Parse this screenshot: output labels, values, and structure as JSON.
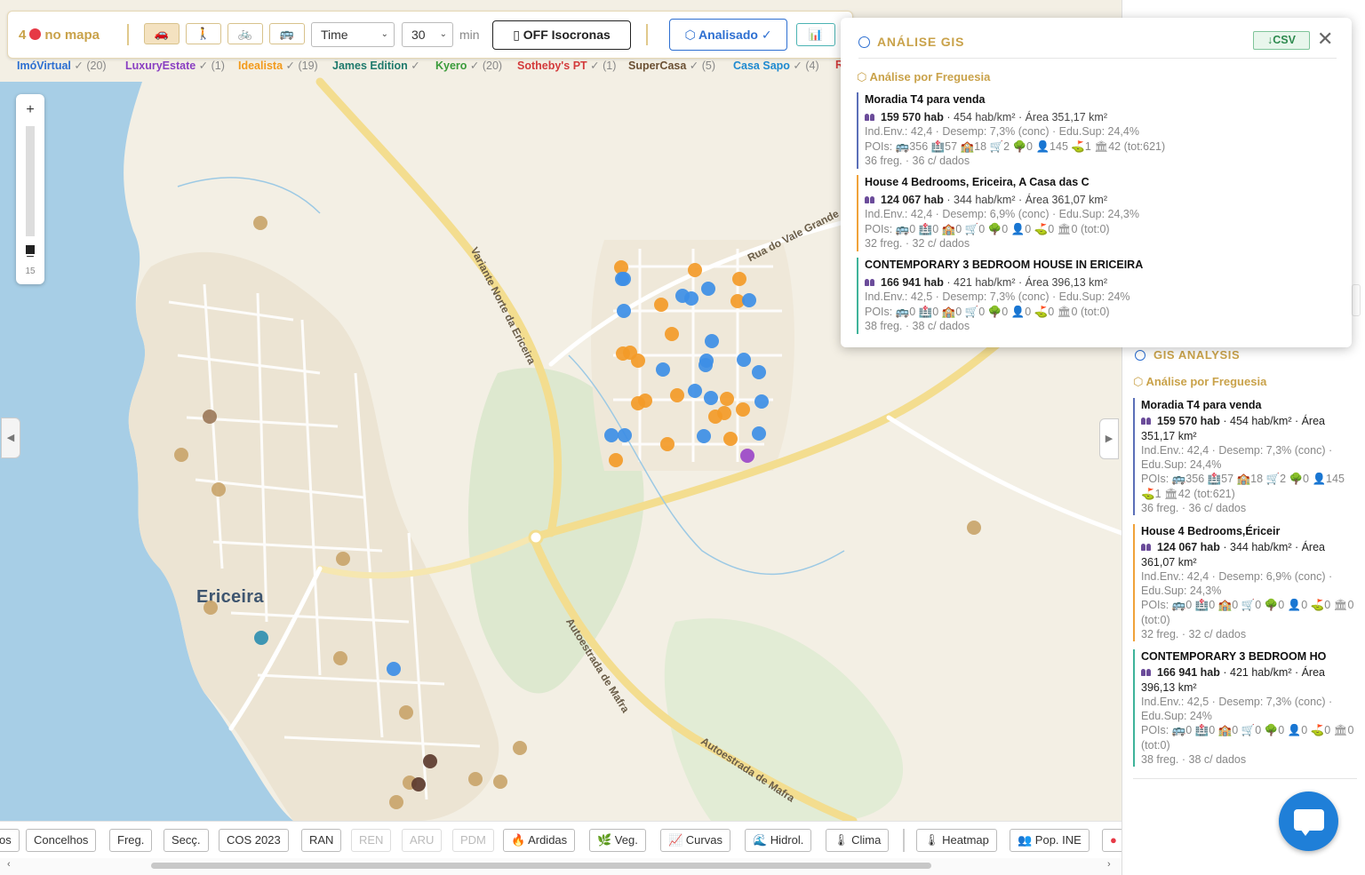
{
  "toolbar": {
    "count_number": "4",
    "count_label": "no mapa",
    "modes": [
      "🚗",
      "🚶",
      "🚲",
      "🚌"
    ],
    "metric_select": "Time",
    "minutes_select": "30",
    "unit": "min",
    "isochrone_button": "▯ OFF  Isocronas",
    "analyzed_button": "⬡ Analisado ✓",
    "chart_icon": "📊"
  },
  "sources": [
    {
      "name": "ImóVirtual",
      "count": " ✓ (20)",
      "color": "#2d6fd1"
    },
    {
      "name": "LuxuryEstate",
      "count": " ✓ (1)",
      "color": "#8a3fc2"
    },
    {
      "name": "Idealista",
      "count": " ✓ (19)",
      "color": "#f29a1b"
    },
    {
      "name": "James Edition",
      "count": " ✓",
      "color": "#1f7a6c"
    },
    {
      "name": "Kyero",
      "count": " ✓ (20)",
      "color": "#3a9b3a"
    },
    {
      "name": "Sotheby's PT",
      "count": " ✓ (1)",
      "color": "#d33b3b"
    },
    {
      "name": "SuperCasa",
      "count": " ✓ (5)",
      "color": "#6b5033"
    },
    {
      "name": "Casa Sapo",
      "count": " ✓ (4)",
      "color": "#1f8ad0"
    },
    {
      "name": "R",
      "count": "",
      "color": "#d33b3b"
    }
  ],
  "map": {
    "place": "Ericeira",
    "roads": [
      "Variante Norte da Ericeira",
      "Rua do Vale Grande",
      "Autoestrada de Mafra",
      "Autoestrada de Mafra"
    ],
    "zoom_in": "+",
    "zoom_out": "−",
    "zoom_level": "15",
    "left_toggle": "◀",
    "right_toggle": "▶",
    "colors": {
      "imovirtual": "#3d8ee6",
      "idealista": "#f39a28",
      "luxury": "#9b47c8",
      "supercasa_light": "#c9a56b",
      "supercasa_mid": "#9c7a5a",
      "supercasa_dark": "#5c3b2e",
      "teal": "#2f8fb0"
    }
  },
  "layers": [
    "os",
    "Concelhos",
    "Freg.",
    "Secç.",
    "COS 2023",
    "RAN",
    "REN",
    "ARU",
    "PDM",
    "🔥 Ardidas",
    "🌿 Veg.",
    "📈 Curvas",
    "🌊 Hidrol.",
    "🌡 Clima",
    "🌡 Heatmap",
    "👥 Pop. INE",
    "●"
  ],
  "popup": {
    "title": "ANÁLISE GIS",
    "csv": "↓CSV",
    "close": "✕",
    "subtitle": "⬡ Análise por Freguesia",
    "cards": [
      {
        "title": "Moradia T4 para venda",
        "pop": "159 570 hab",
        "dens": " · 454 hab/km² · Área 351,17 km²",
        "ind": "Ind.Env.: 42,4 · Desemp: 7,3% (conc) · Edu.Sup: 24,4%",
        "pois": "POIs: 🚌356 🏥57 🏫18 🛒2 🌳0 👤145 ⛳1 🏛42 (tot:621)",
        "freg": "36 freg. · 36 c/ dados",
        "color": "#5b6fb8"
      },
      {
        "title": "House 4 Bedrooms, Ericeira, A Casa das C",
        "pop": "124 067 hab",
        "dens": " · 344 hab/km² · Área 361,07 km²",
        "ind": "Ind.Env.: 42,4 · Desemp: 6,9% (conc) · Edu.Sup: 24,3%",
        "pois": "POIs: 🚌0 🏥0 🏫0 🛒0 🌳0 👤0 ⛳0 🏛0 (tot:0)",
        "freg": "32 freg. · 32 c/ dados",
        "color": "#f0a23a"
      },
      {
        "title": "CONTEMPORARY 3 BEDROOM HOUSE IN ERICEIRA",
        "pop": "166 941 hab",
        "dens": " · 421 hab/km² · Área 396,13 km²",
        "ind": "Ind.Env.: 42,5 · Desemp: 7,3% (conc) · Edu.Sup: 24%",
        "pois": "POIs: 🚌0 🏥0 🏫0 🛒0 🌳0 👤0 ⛳0 🏛0 (tot:0)",
        "freg": "38 freg. · 38 c/ dados",
        "color": "#3fb39a"
      }
    ]
  },
  "side_panel": {
    "title": "GIS ANALYSIS",
    "subtitle": "⬡ Análise por Freguesia",
    "cards": [
      {
        "title": "Moradia T4 para venda",
        "pop": "159 570 hab",
        "rest": " · 454 hab/km² · Área 351,17 km²",
        "ind": "Ind.Env.: 42,4 · Desemp: 7,3% (conc) · Edu.Sup: 24,4%",
        "pois": "POIs: 🚌356 🏥57 🏫18 🛒2 🌳0 👤145 ⛳1 🏛42 (tot:621)",
        "freg": "36 freg. · 36 c/ dados",
        "color": "#5b6fb8"
      },
      {
        "title": "House 4 Bedrooms,Ériceir",
        "pop": "124 067 hab",
        "rest": " · 344 hab/km² · Área 361,07 km²",
        "ind": "Ind.Env.: 42,4 · Desemp: 6,9% (conc) · Edu.Sup: 24,3%",
        "pois": "POIs: 🚌0 🏥0 🏫0 🛒0 🌳0 👤0 ⛳0 🏛0 (tot:0)",
        "freg": "32 freg. · 32 c/ dados",
        "color": "#f0a23a"
      },
      {
        "title": "CONTEMPORARY 3 BEDROOM HO",
        "pop": "166 941 hab",
        "rest": " · 421 hab/km² · Área 396,13 km²",
        "ind": "Ind.Env.: 42,5 · Desemp: 7,3% (conc) · Edu.Sup: 24%",
        "pois": "POIs: 🚌0 🏥0 🏫0 🛒0 🌳0 👤0 ⛳0 🏛0 (tot:0)",
        "freg": "38 freg. · 38 c/ dados",
        "color": "#3fb39a"
      }
    ]
  }
}
